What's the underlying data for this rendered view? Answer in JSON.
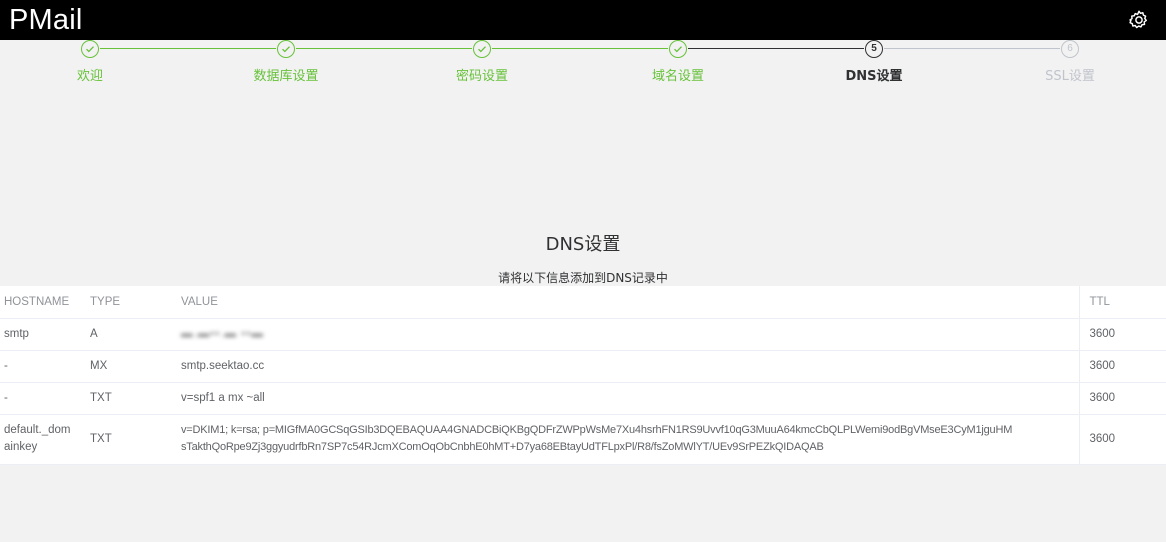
{
  "app": {
    "title": "PMail",
    "settings_icon": "gear-icon"
  },
  "stepper": {
    "steps": [
      {
        "label": "欢迎",
        "status": "done"
      },
      {
        "label": "数据库设置",
        "status": "done"
      },
      {
        "label": "密码设置",
        "status": "done"
      },
      {
        "label": "域名设置",
        "status": "done"
      },
      {
        "label": "DNS设置",
        "number": "5",
        "status": "current"
      },
      {
        "label": "SSL设置",
        "number": "6",
        "status": "pending"
      }
    ],
    "colors": {
      "done": "#67c23a",
      "current": "#303133",
      "pending": "#c0c4cc"
    }
  },
  "section": {
    "title": "DNS设置",
    "subtitle": "请将以下信息添加到DNS记录中"
  },
  "table": {
    "headers": {
      "hostname": "HOSTNAME",
      "type": "TYPE",
      "value": "VALUE",
      "ttl": "TTL"
    },
    "rows": [
      {
        "hostname": "smtp",
        "type": "A",
        "value": "▬.▬▪▪.▬ ▪▪▬",
        "value_blurred": true,
        "ttl": "3600"
      },
      {
        "hostname": "-",
        "type": "MX",
        "value": "smtp.seektao.cc",
        "ttl": "3600"
      },
      {
        "hostname": "-",
        "type": "TXT",
        "value": "v=spf1 a mx ~all",
        "ttl": "3600"
      },
      {
        "hostname": "default._domainkey",
        "hostname_line1": "default._dom",
        "hostname_line2": "ainkey",
        "type": "TXT",
        "value_line1": "v=DKIM1; k=rsa; p=MIGfMA0GCSqGSIb3DQEBAQUAA4GNADCBiQKBgQDFrZWPpWsMe7Xu4hsrhFN1RS9Uvvf10qG3MuuA64kmcCbQLPLWemi9odBgVMseE3CyM1jguHM",
        "value_line2": "sTakthQoRpe9Zj3ggyudrfbRn7SP7c54RJcmXComOqObCnbhE0hMT+D7ya68EBtayUdTFLpxPl/R8/fsZoMWlYT/UEv9SrPEZkQIDAQAB",
        "ttl": "3600"
      }
    ]
  }
}
